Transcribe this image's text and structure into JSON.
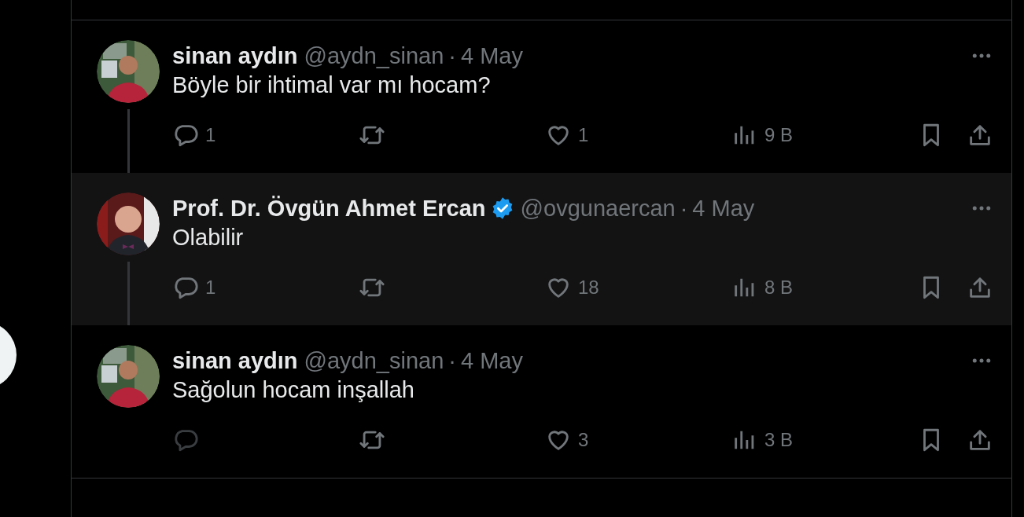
{
  "posts": [
    {
      "name": "sinan aydın",
      "verified": false,
      "handle": "@aydn_sinan",
      "separator": "·",
      "date": "4 May",
      "text": "Böyle bir ihtimal var mı hocam?",
      "highlighted": false,
      "thread_line": true,
      "reply": {
        "count": "1",
        "disabled": false
      },
      "like": "1",
      "views": "9 B"
    },
    {
      "name": "Prof. Dr. Övgün Ahmet Ercan",
      "verified": true,
      "handle": "@ovgunaercan",
      "separator": "·",
      "date": "4 May",
      "text": "Olabilir",
      "highlighted": true,
      "thread_line": true,
      "reply": {
        "count": "1",
        "disabled": false
      },
      "like": "18",
      "views": "8 B"
    },
    {
      "name": "sinan aydın",
      "verified": false,
      "handle": "@aydn_sinan",
      "separator": "·",
      "date": "4 May",
      "text": "Sağolun hocam inşallah",
      "highlighted": false,
      "thread_line": false,
      "reply": {
        "disabled": true
      },
      "like": "3",
      "views": "3 B"
    }
  ]
}
